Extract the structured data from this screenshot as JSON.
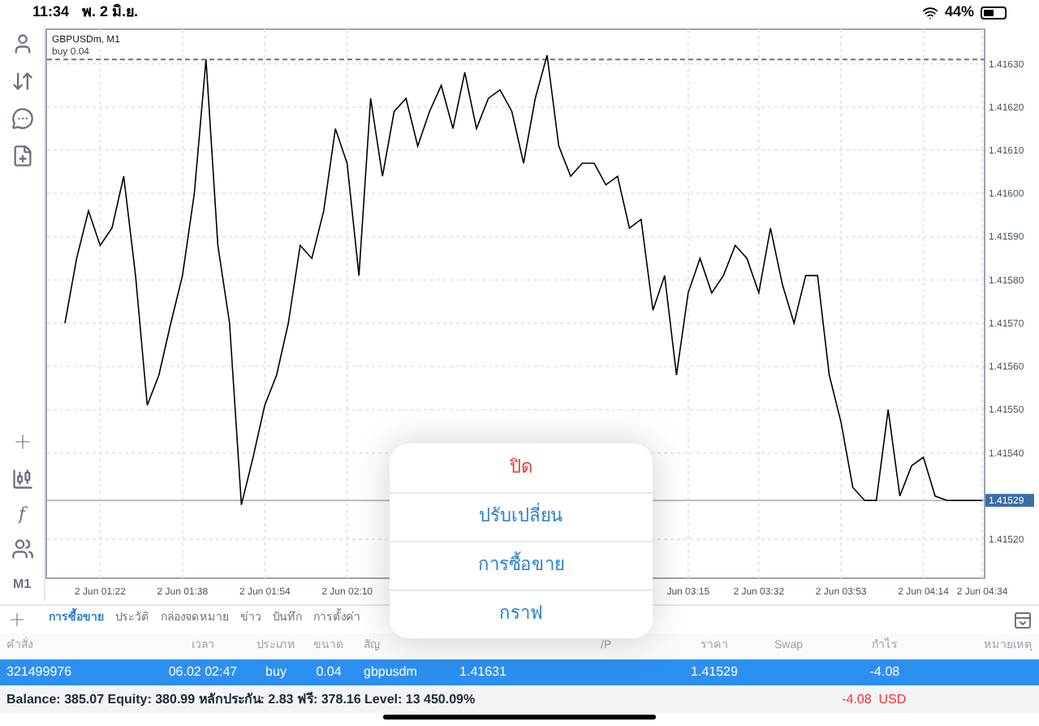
{
  "status_bar": {
    "time": "11:34",
    "date": "พ. 2 มิ.ย.",
    "battery": "44%"
  },
  "toolbar": {
    "function_glyph": "f",
    "timeframe": "M1"
  },
  "chart": {
    "chart_data": {
      "type": "line",
      "grid": true,
      "ylim": [
        1.41511,
        1.41638
      ],
      "yticks": [
        {
          "value": 1.4152,
          "label": "1.41520"
        },
        {
          "value": 1.4154,
          "label": "1.41540"
        },
        {
          "value": 1.4155,
          "label": "1.41550"
        },
        {
          "value": 1.4156,
          "label": "1.41560"
        },
        {
          "value": 1.4157,
          "label": "1.41570"
        },
        {
          "value": 1.4158,
          "label": "1.41580"
        },
        {
          "value": 1.4159,
          "label": "1.41590"
        },
        {
          "value": 1.416,
          "label": "1.41600"
        },
        {
          "value": 1.4161,
          "label": "1.41610"
        },
        {
          "value": 1.4162,
          "label": "1.41620"
        },
        {
          "value": 1.4163,
          "label": "1.41630"
        }
      ],
      "categories": [
        null,
        null,
        null,
        "2 Jun 01:22",
        null,
        null,
        null,
        null,
        null,
        null,
        "2 Jun 01:38",
        null,
        null,
        null,
        null,
        null,
        null,
        "2 Jun 01:54",
        null,
        null,
        null,
        null,
        null,
        null,
        "2 Jun 02:10",
        null,
        null,
        null,
        null,
        null,
        null,
        null,
        null,
        null,
        null,
        null,
        null,
        null,
        null,
        null,
        null,
        null,
        null,
        null,
        null,
        null,
        null,
        null,
        null,
        null,
        null,
        null,
        null,
        "Jun 03:15",
        null,
        null,
        null,
        null,
        null,
        "2 Jun 03:32",
        null,
        null,
        null,
        null,
        null,
        null,
        "2 Jun 03:53",
        null,
        null,
        null,
        null,
        null,
        null,
        "2 Jun 04:14",
        null,
        null,
        null,
        null,
        "2 Jun 04:34"
      ],
      "series": [
        {
          "name": "GBPUSDm, M1",
          "color": "#000000",
          "values": [
            1.4157,
            1.41585,
            1.41596,
            1.41588,
            1.41592,
            1.41604,
            1.41581,
            1.41551,
            1.41558,
            1.4157,
            1.41581,
            1.416,
            1.41631,
            1.41588,
            1.4157,
            1.41528,
            1.41539,
            1.41551,
            1.41558,
            1.4157,
            1.41588,
            1.41585,
            1.41596,
            1.41615,
            1.41607,
            1.41581,
            1.41622,
            1.41604,
            1.41619,
            1.41622,
            1.41611,
            1.41619,
            1.41625,
            1.41615,
            1.41628,
            1.41615,
            1.41622,
            1.41624,
            1.41619,
            1.41607,
            1.41622,
            1.41632,
            1.41611,
            1.41604,
            1.41607,
            1.41607,
            1.41602,
            1.41604,
            1.41592,
            1.41594,
            1.41573,
            1.41581,
            1.41558,
            1.41577,
            1.41585,
            1.41577,
            1.41581,
            1.41588,
            1.41585,
            1.41577,
            1.41592,
            1.41579,
            1.4157,
            1.41581,
            1.41581,
            1.41558,
            1.41547,
            1.41532,
            1.41529,
            1.41529,
            1.4155,
            1.4153,
            1.41537,
            1.41539,
            1.4153,
            1.41529,
            1.41529,
            1.41529,
            1.41529
          ]
        }
      ],
      "ref_lines": [
        {
          "axis": "y",
          "value": 1.41631,
          "label": "buy 0.04"
        },
        {
          "axis": "y",
          "value": 1.41529,
          "label": "1.41529"
        }
      ]
    }
  },
  "tabs": [
    {
      "label": "การซื้อขาย",
      "selected": true
    },
    {
      "label": "ประวัติ",
      "selected": false
    },
    {
      "label": "กล่องจดหมาย",
      "selected": false
    },
    {
      "label": "ข่าว",
      "selected": false
    },
    {
      "label": "บันทึก",
      "selected": false
    },
    {
      "label": "การตั้งค่า",
      "selected": false
    }
  ],
  "table": {
    "columns": [
      "คำสั่ง",
      "เวลา",
      "ประเภท",
      "ขนาด",
      "สัญ",
      "",
      "",
      "/P",
      "ราคา",
      "Swap",
      "กำไร",
      "หมายเหตุ"
    ],
    "rows": [
      {
        "selected": true,
        "cells": [
          "321499976",
          "06.02 02:47",
          "buy",
          "0.04",
          "gbpusdm",
          "1.41631",
          "",
          "",
          "1.41529",
          "",
          "-4.08",
          ""
        ]
      }
    ]
  },
  "summary": {
    "text": "Balance: 385.07 Equity: 380.99 หลักประกัน: 2.83 ฟรี: 378.16 Level: 13 450.09%",
    "profit": "-4.08  USD"
  },
  "menu": {
    "items": [
      {
        "label": "ปิด",
        "kind": "destructive"
      },
      {
        "label": "ปรับเปลี่ยน",
        "kind": "default"
      },
      {
        "label": "การซื้อขาย",
        "kind": "default"
      },
      {
        "label": "กราฟ",
        "kind": "default"
      }
    ]
  }
}
